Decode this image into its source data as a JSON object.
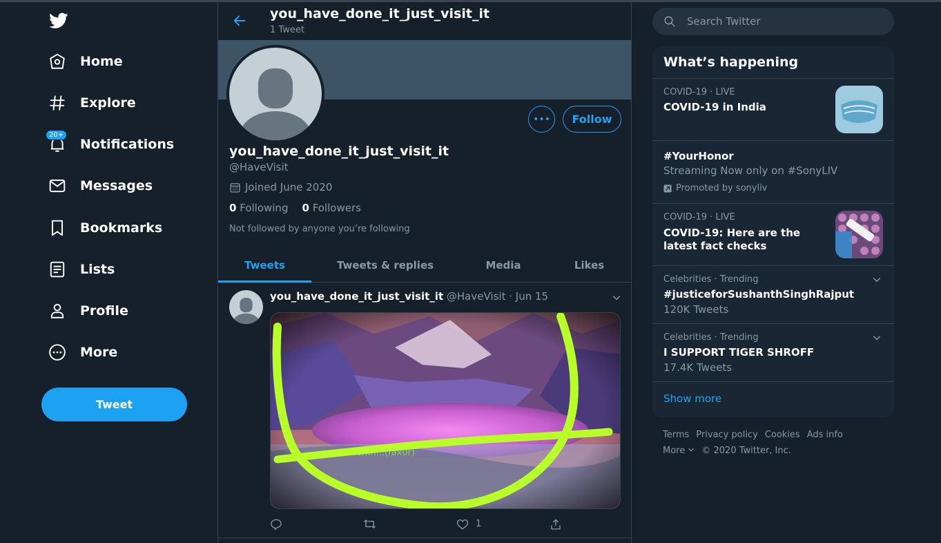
{
  "nav": {
    "items": [
      {
        "label": "Home",
        "icon": "home-icon"
      },
      {
        "label": "Explore",
        "icon": "hashtag-icon"
      },
      {
        "label": "Notifications",
        "icon": "bell-icon",
        "badge": "20+"
      },
      {
        "label": "Messages",
        "icon": "envelope-icon"
      },
      {
        "label": "Bookmarks",
        "icon": "bookmark-icon"
      },
      {
        "label": "Lists",
        "icon": "list-icon"
      },
      {
        "label": "Profile",
        "icon": "person-icon"
      },
      {
        "label": "More",
        "icon": "more-circle-icon"
      }
    ],
    "tweet_button": "Tweet"
  },
  "header": {
    "title": "you_have_done_it_just_visit_it",
    "subtitle": "1 Tweet"
  },
  "profile": {
    "name": "you_have_done_it_just_visit_it",
    "handle": "@HaveVisit",
    "joined": "Joined June 2020",
    "following_count": "0",
    "following_label": "Following",
    "followers_count": "0",
    "followers_label": "Followers",
    "note": "Not followed by anyone you’re following",
    "follow_label": "Follow",
    "more_label": "•••"
  },
  "tabs": [
    {
      "label": "Tweets",
      "active": true
    },
    {
      "label": "Tweets & replies",
      "active": false
    },
    {
      "label": "Media",
      "active": false
    },
    {
      "label": "Likes",
      "active": false
    }
  ],
  "tweet": {
    "author": "you_have_done_it_just_visit_it",
    "handle": "@HaveVisit",
    "separator": "·",
    "date": "Jun 15",
    "like_count": "1",
    "image_watermark": "t.co/xh...(fax0r)"
  },
  "search": {
    "placeholder": "Search Twitter"
  },
  "trends": {
    "title": "What’s happening",
    "items": [
      {
        "meta": "COVID-19 · LIVE",
        "title": "COVID-19 in India"
      },
      {
        "title": "#YourHonor",
        "sub": "Streaming Now only on #SonyLIV",
        "promoted": "Promoted by sonyliv"
      },
      {
        "meta": "COVID-19 · LIVE",
        "title": "COVID-19: Here are the latest fact checks"
      },
      {
        "meta": "Celebrities · Trending",
        "title": "#justiceforSushanthSinghRajput",
        "sub": "120K Tweets"
      },
      {
        "meta": "Celebrities · Trending",
        "title": "I SUPPORT TIGER SHROFF",
        "sub": "17.4K Tweets"
      }
    ],
    "show_more": "Show more"
  },
  "footer": {
    "links": [
      "Terms",
      "Privacy policy",
      "Cookies",
      "Ads info"
    ],
    "more": "More",
    "copyright": "© 2020 Twitter, Inc."
  },
  "colors": {
    "background": "#15202b",
    "panel": "#192734",
    "accent": "#1da1f2",
    "muted": "#8899a6",
    "border": "#38444d",
    "banner": "#3d5466"
  }
}
